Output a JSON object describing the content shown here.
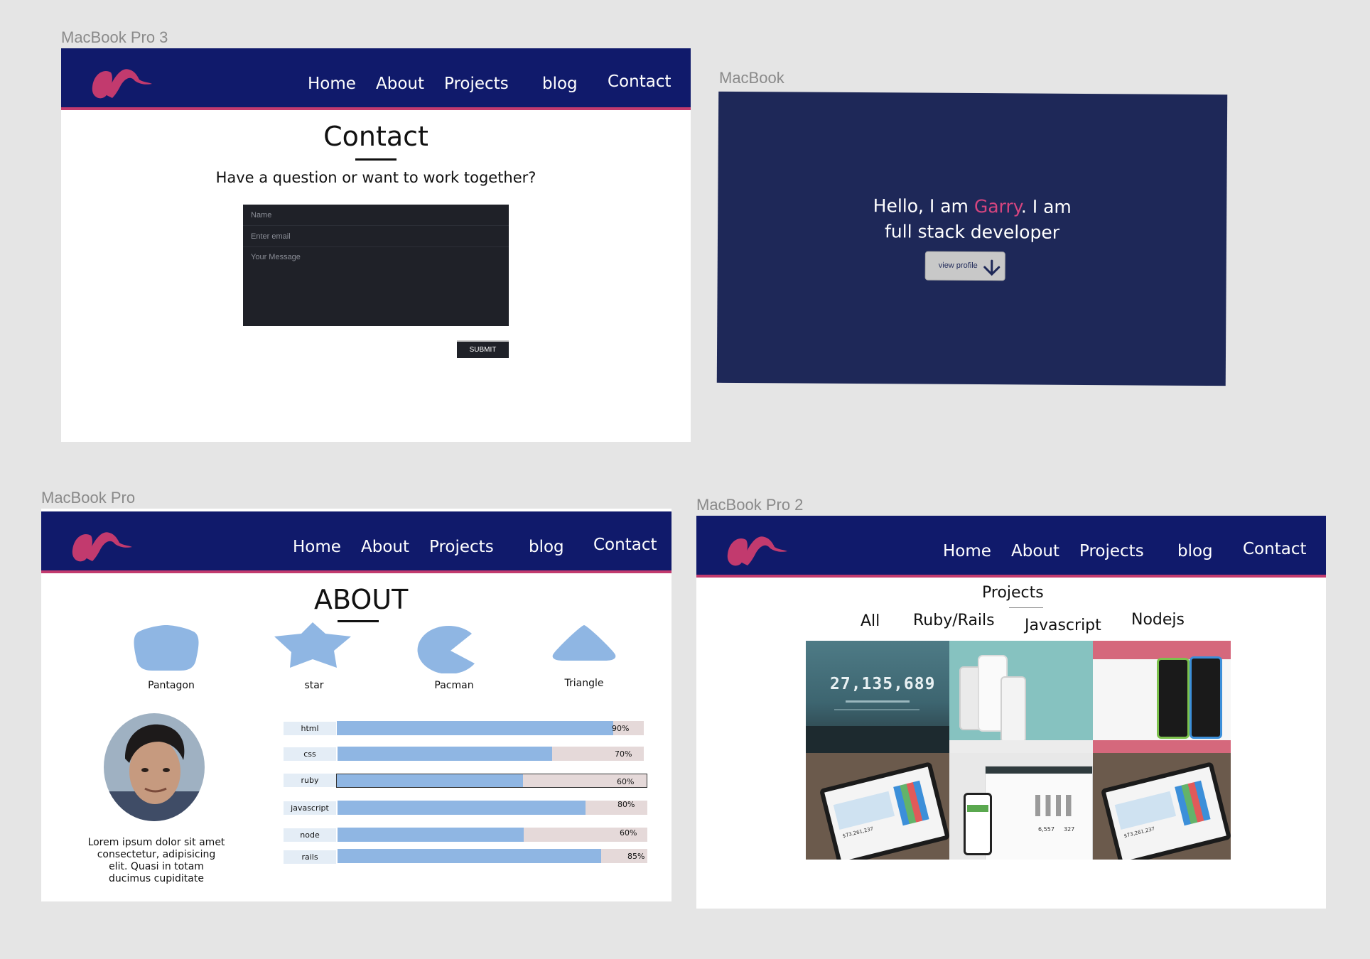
{
  "labels": {
    "contact_frame": "MacBook Pro 3",
    "hero_frame": "MacBook",
    "about_frame": "MacBook Pro",
    "projects_frame": "MacBook Pro 2"
  },
  "nav": {
    "home": "Home",
    "about": "About",
    "projects": "Projects",
    "blog": "blog",
    "contact": "Contact"
  },
  "contact": {
    "title": "Contact",
    "subtitle": "Have a question or want to work together?",
    "name_placeholder": "Name",
    "email_placeholder": "Enter email",
    "message_placeholder": "Your Message",
    "submit": "SUBMIT"
  },
  "hero": {
    "greeting": "Hello, I am ",
    "name": "Garry",
    "line1_end": ". I am",
    "line2": "full stack developer",
    "button": "view profile"
  },
  "about": {
    "title": "ABOUT",
    "shapes": [
      "Pantagon",
      "star",
      "Pacman",
      "Triangle"
    ],
    "bio": "Lorem ipsum dolor sit amet consectetur, adipisicing elit. Quasi in totam ducimus cupiditate",
    "skills": [
      {
        "name": "html",
        "percent": 90,
        "label": "90%"
      },
      {
        "name": "css",
        "percent": 70,
        "label": "70%"
      },
      {
        "name": "ruby",
        "percent": 60,
        "label": "60%"
      },
      {
        "name": "javascript",
        "percent": 80,
        "label": "80%"
      },
      {
        "name": "node",
        "percent": 60,
        "label": "60%"
      },
      {
        "name": "rails",
        "percent": 85,
        "label": "85%"
      }
    ]
  },
  "projects": {
    "title": "Projects",
    "filters": [
      "All",
      "Ruby/Rails",
      "Javascript",
      "Nodejs"
    ],
    "counter": "27,135,689",
    "tiles": [
      "counter-site",
      "app-showcase",
      "phone-app",
      "tablet-chart",
      "fitness-tracker",
      "tablet-chart-2"
    ],
    "tracker_values": [
      "6,557",
      "327"
    ],
    "tablet_value": "$73,261,237"
  },
  "colors": {
    "nav_bg": "#101a6b",
    "accent": "#c23a6e",
    "hero_bg": "#1e2858",
    "skill_fill": "#8fb6e3"
  }
}
